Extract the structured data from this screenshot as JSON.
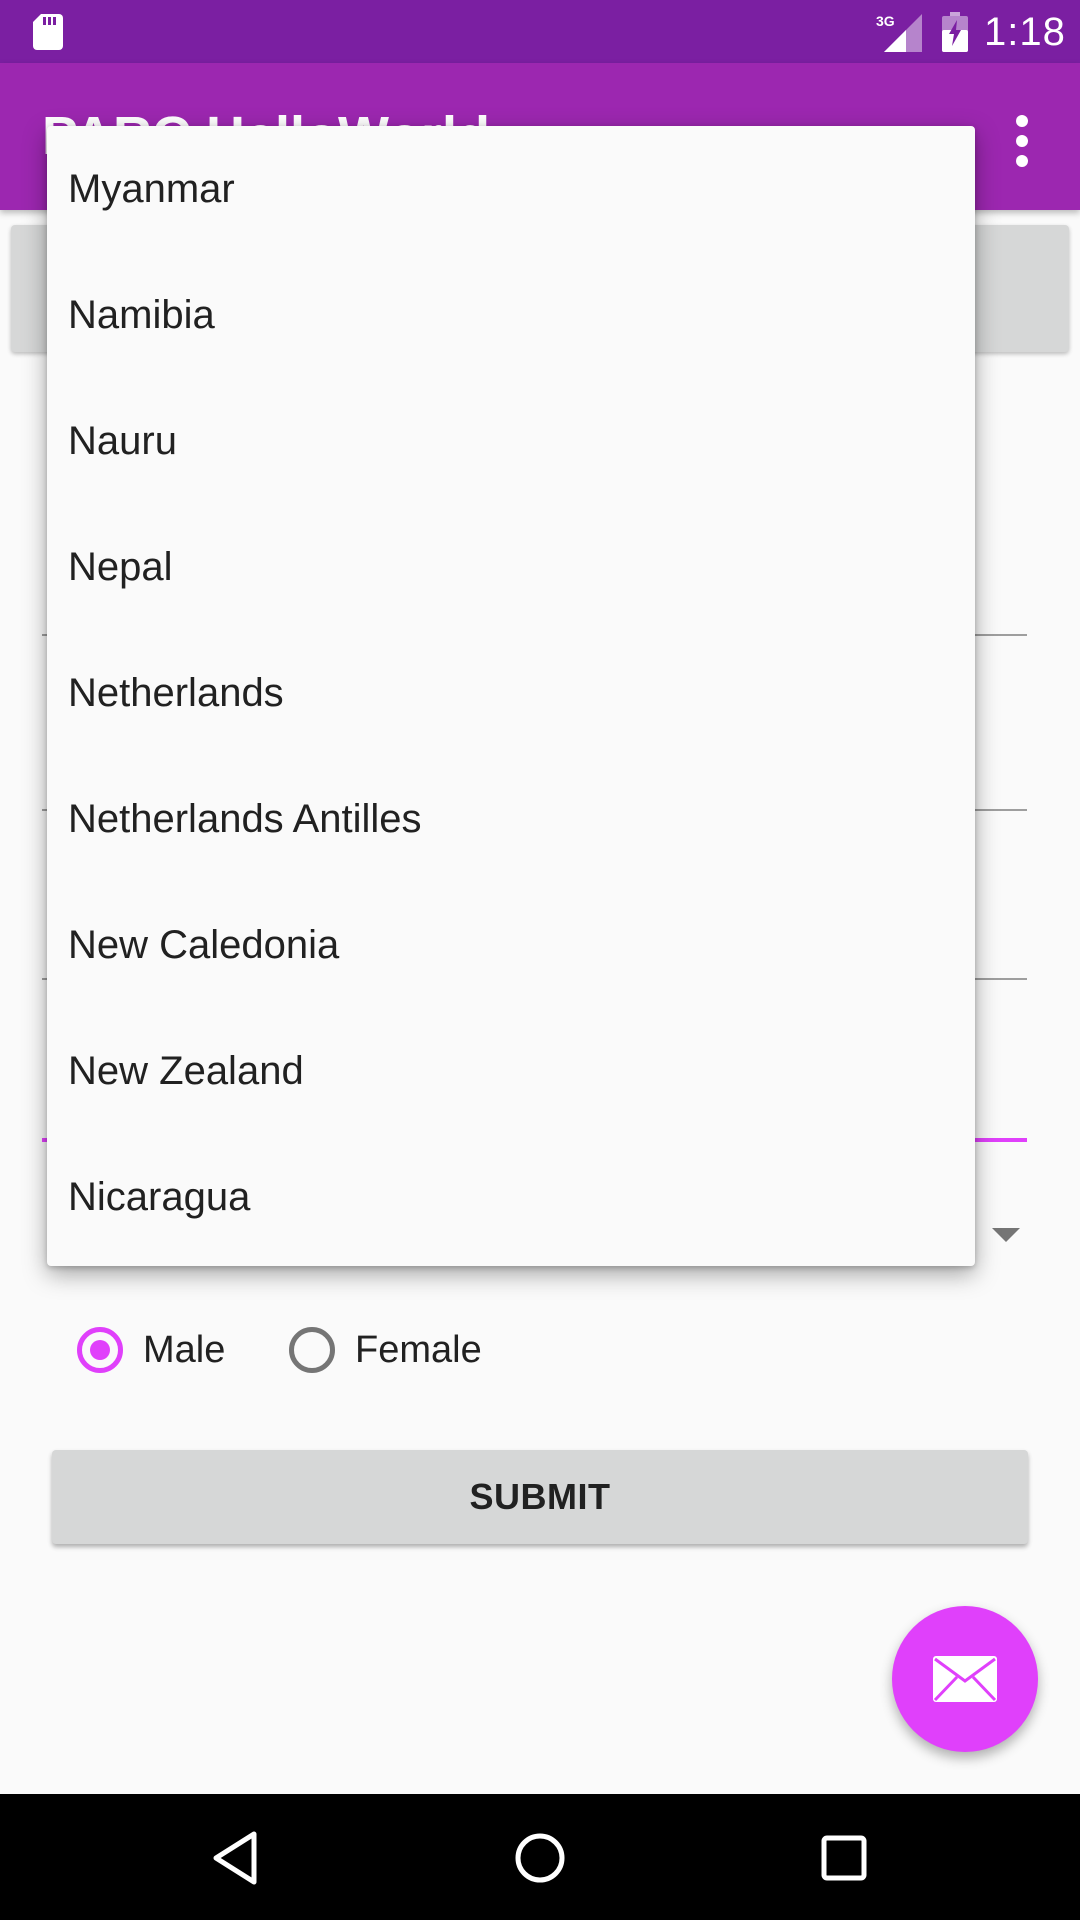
{
  "status_bar": {
    "time": "1:18",
    "network_label": "3G",
    "icons": [
      "sd-card-icon",
      "signal-3g-icon",
      "battery-charging-icon"
    ]
  },
  "app_bar": {
    "title": "PARC HelloWorld",
    "overflow_icon": "more-vert-icon"
  },
  "dropdown": {
    "items": [
      "Myanmar",
      "Namibia",
      "Nauru",
      "Nepal",
      "Netherlands",
      "Netherlands Antilles",
      "New Caledonia",
      "New Zealand",
      "Nicaragua"
    ]
  },
  "gender": {
    "options": [
      {
        "label": "Male",
        "checked": true
      },
      {
        "label": "Female",
        "checked": false
      }
    ]
  },
  "submit": {
    "label": "SUBMIT"
  },
  "fab": {
    "icon": "mail-icon"
  },
  "colors": {
    "status_bar": "#7b1fa2",
    "app_bar": "#9c27b0",
    "accent": "#e040fb",
    "button_gray": "#d6d7d7"
  },
  "nav_bar": {
    "icons": [
      "back-icon",
      "home-icon",
      "recents-icon"
    ]
  }
}
